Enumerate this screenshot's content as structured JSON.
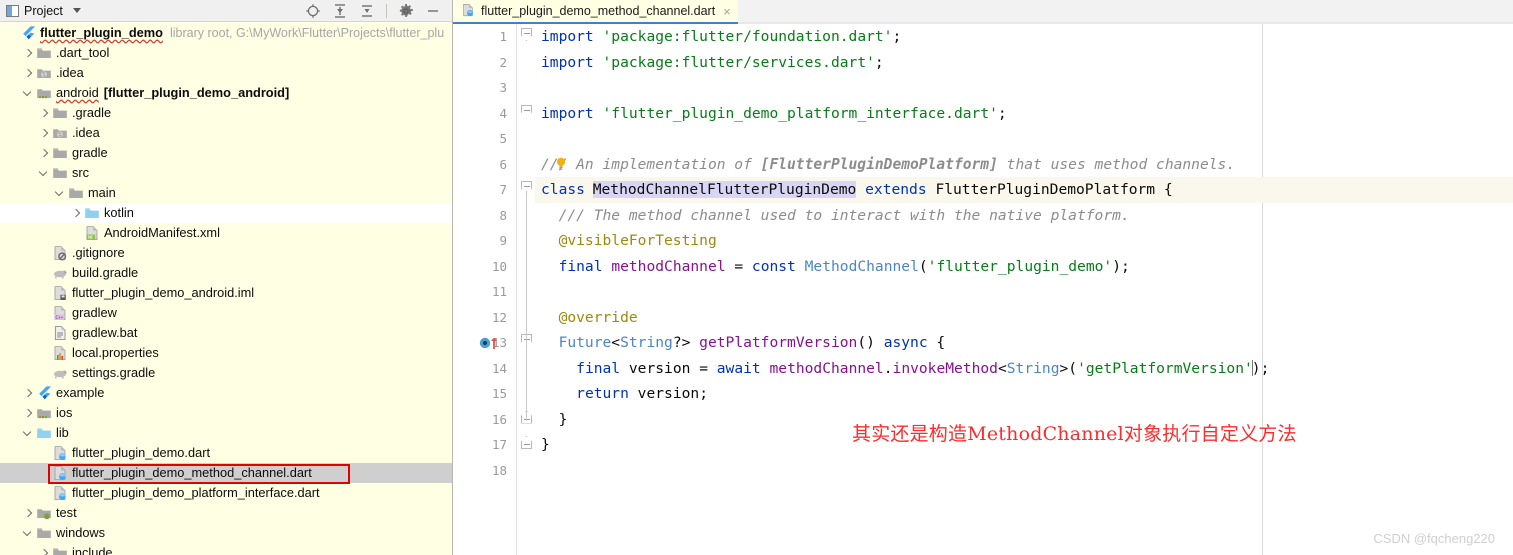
{
  "window": {
    "tool_window_title": "Project",
    "toolbar_icons": [
      "locate-target-icon",
      "expand-all-icon",
      "collapse-all-icon",
      "settings-gear-icon",
      "hide-minimize-icon"
    ]
  },
  "project_tree": {
    "root": {
      "label": "flutter_plugin_demo",
      "meta": "library root,  G:\\MyWork\\Flutter\\Projects\\flutter_plu"
    },
    "items": [
      {
        "label": ".dart_tool",
        "indent": 1,
        "arrow": "right",
        "icon": "folder-icon",
        "state": "normal"
      },
      {
        "label": ".idea",
        "indent": 1,
        "arrow": "right",
        "icon": "folder-idea-icon",
        "state": "normal"
      },
      {
        "label": "android",
        "suffix": "[flutter_plugin_demo_android]",
        "indent": 1,
        "arrow": "down",
        "icon": "folder-android-icon",
        "state": "normal"
      },
      {
        "label": ".gradle",
        "indent": 2,
        "arrow": "right",
        "icon": "folder-icon",
        "state": "normal"
      },
      {
        "label": ".idea",
        "indent": 2,
        "arrow": "right",
        "icon": "folder-idea-icon",
        "state": "normal"
      },
      {
        "label": "gradle",
        "indent": 2,
        "arrow": "right",
        "icon": "folder-icon",
        "state": "normal"
      },
      {
        "label": "src",
        "indent": 2,
        "arrow": "down",
        "icon": "folder-icon",
        "state": "normal"
      },
      {
        "label": "main",
        "indent": 3,
        "arrow": "down",
        "icon": "folder-icon",
        "state": "normal"
      },
      {
        "label": "kotlin",
        "indent": 4,
        "arrow": "right",
        "icon": "folder-source-icon",
        "state": "hover"
      },
      {
        "label": "AndroidManifest.xml",
        "indent": 4,
        "arrow": "none",
        "icon": "manifest-file-icon",
        "state": "normal"
      },
      {
        "label": ".gitignore",
        "indent": 2,
        "arrow": "none",
        "icon": "gitignore-file-icon",
        "state": "normal"
      },
      {
        "label": "build.gradle",
        "indent": 2,
        "arrow": "none",
        "icon": "gradle-file-icon",
        "state": "normal"
      },
      {
        "label": "flutter_plugin_demo_android.iml",
        "indent": 2,
        "arrow": "none",
        "icon": "iml-file-icon",
        "state": "normal"
      },
      {
        "label": "gradlew",
        "indent": 2,
        "arrow": "none",
        "icon": "cpp-file-icon",
        "state": "normal"
      },
      {
        "label": "gradlew.bat",
        "indent": 2,
        "arrow": "none",
        "icon": "bat-file-icon",
        "state": "normal"
      },
      {
        "label": "local.properties",
        "indent": 2,
        "arrow": "none",
        "icon": "properties-file-icon",
        "state": "normal"
      },
      {
        "label": "settings.gradle",
        "indent": 2,
        "arrow": "none",
        "icon": "gradle-file-icon",
        "state": "normal"
      },
      {
        "label": "example",
        "indent": 1,
        "arrow": "right",
        "icon": "flutter-icon",
        "state": "normal"
      },
      {
        "label": "ios",
        "indent": 1,
        "arrow": "right",
        "icon": "folder-ios-icon",
        "state": "normal"
      },
      {
        "label": "lib",
        "indent": 1,
        "arrow": "down",
        "icon": "folder-source-icon",
        "state": "normal"
      },
      {
        "label": "flutter_plugin_demo.dart",
        "indent": 2,
        "arrow": "none",
        "icon": "dart-file-icon",
        "state": "normal"
      },
      {
        "label": "flutter_plugin_demo_method_channel.dart",
        "indent": 2,
        "arrow": "none",
        "icon": "dart-file-icon",
        "state": "selected"
      },
      {
        "label": "flutter_plugin_demo_platform_interface.dart",
        "indent": 2,
        "arrow": "none",
        "icon": "dart-file-icon",
        "state": "normal"
      },
      {
        "label": "test",
        "indent": 1,
        "arrow": "right",
        "icon": "folder-test-icon",
        "state": "normal"
      },
      {
        "label": "windows",
        "indent": 1,
        "arrow": "down",
        "icon": "folder-icon",
        "state": "normal"
      },
      {
        "label": "include",
        "indent": 2,
        "arrow": "right",
        "icon": "folder-icon",
        "state": "normal"
      }
    ]
  },
  "editor": {
    "tab": {
      "label": "flutter_plugin_demo_method_channel.dart",
      "icon": "dart-file-icon",
      "close_label": "×"
    },
    "line_numbers": [
      "1",
      "2",
      "3",
      "4",
      "5",
      "6",
      "7",
      "8",
      "9",
      "10",
      "11",
      "12",
      "13",
      "14",
      "15",
      "16",
      "17",
      "18"
    ],
    "lines": [
      "import 'package:flutter/foundation.dart';",
      "import 'package:flutter/services.dart';",
      "",
      "import 'flutter_plugin_demo_platform_interface.dart';",
      "",
      "/// An implementation of [FlutterPluginDemoPlatform] that uses method channels.",
      "class MethodChannelFlutterPluginDemo extends FlutterPluginDemoPlatform {",
      "  /// The method channel used to interact with the native platform.",
      "  @visibleForTesting",
      "  final methodChannel = const MethodChannel('flutter_plugin_demo');",
      "",
      "  @override",
      "  Future<String?> getPlatformVersion() async {",
      "    final version = await methodChannel.invokeMethod<String>('getPlatformVersion');",
      "    return version;",
      "  }",
      "}",
      ""
    ],
    "caret_line": 7,
    "gutter_markers": [
      {
        "line": 13,
        "icon": "overriding-method-icon"
      }
    ],
    "annotation": "其实还是构造MethodChannel对象执行自定义方法",
    "watermark": "CSDN @fqcheng220"
  },
  "colors": {
    "tree_bg": "#FFFFE4",
    "selection_bg": "#CFCFCF",
    "selection_outline": "#E20000",
    "tab_underline": "#3C7FD9",
    "keyword": "#0033B3",
    "string": "#067D17",
    "comment": "#8C8C8C",
    "annotation": "#9E880D",
    "class_name": "#4A86C8",
    "field": "#871094",
    "annot_red": "#FF2B2B",
    "watermark": "#CFCFCF"
  }
}
